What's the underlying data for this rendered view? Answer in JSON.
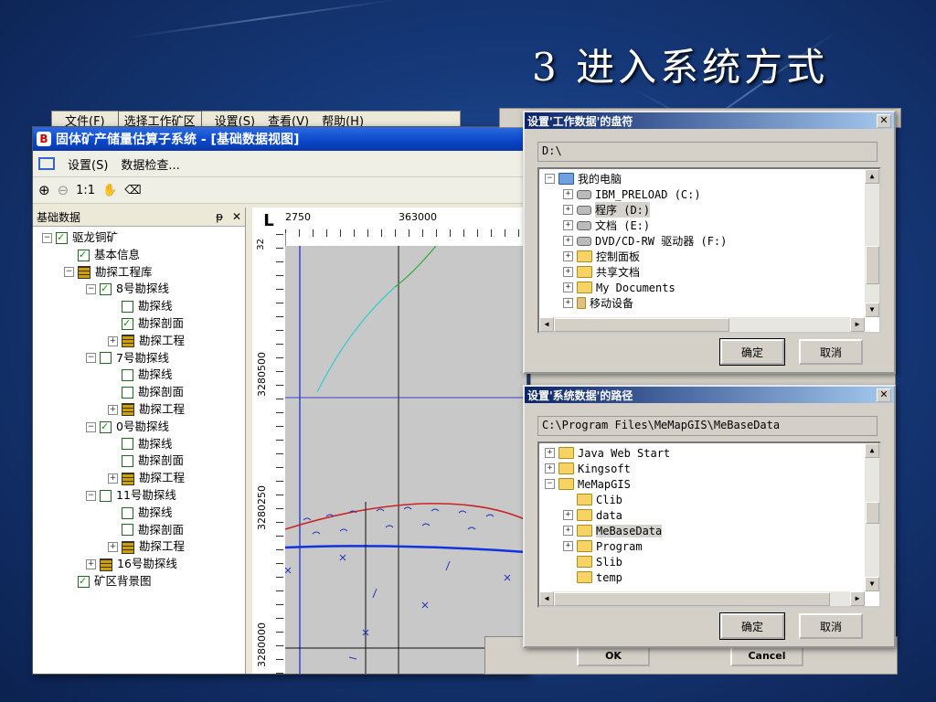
{
  "slide": {
    "title": "3 进入系统方式"
  },
  "back_window": {
    "menu": [
      "文件(F)",
      "选择工作矿区",
      "设置(S)",
      "查看(V)",
      "帮助(H)"
    ]
  },
  "app": {
    "title": "固体矿产储量估算子系统 - [基础数据视图]",
    "logo": "B",
    "toolbar1": {
      "settings": "设置(S)",
      "check": "数据检查..."
    },
    "toolbar2": {
      "zoom_in": "⊕",
      "zoom_out": "⊖",
      "ratio": "1:1",
      "hand": "✋",
      "eraser": "⌫"
    },
    "panel": {
      "title": "基础数据",
      "pin": "ᵽ",
      "close": "✕"
    },
    "tree": [
      {
        "indent": 0,
        "exp": "−",
        "chk": true,
        "label": "驱龙铜矿"
      },
      {
        "indent": 1,
        "exp": "",
        "chk": true,
        "label": "基本信息"
      },
      {
        "indent": 1,
        "exp": "−",
        "icon": "book",
        "label": "勘探工程库"
      },
      {
        "indent": 2,
        "exp": "−",
        "chk": true,
        "label": "8号勘探线"
      },
      {
        "indent": 3,
        "exp": "",
        "chk": false,
        "label": "勘探线"
      },
      {
        "indent": 3,
        "exp": "",
        "chk": true,
        "label": "勘探剖面"
      },
      {
        "indent": 3,
        "exp": "+",
        "icon": "book",
        "label": "勘探工程"
      },
      {
        "indent": 2,
        "exp": "−",
        "chk": false,
        "label": "7号勘探线"
      },
      {
        "indent": 3,
        "exp": "",
        "chk": false,
        "label": "勘探线"
      },
      {
        "indent": 3,
        "exp": "",
        "chk": false,
        "label": "勘探剖面"
      },
      {
        "indent": 3,
        "exp": "+",
        "icon": "book",
        "label": "勘探工程"
      },
      {
        "indent": 2,
        "exp": "−",
        "chk": true,
        "label": "0号勘探线"
      },
      {
        "indent": 3,
        "exp": "",
        "chk": false,
        "label": "勘探线"
      },
      {
        "indent": 3,
        "exp": "",
        "chk": false,
        "label": "勘探剖面"
      },
      {
        "indent": 3,
        "exp": "+",
        "icon": "book",
        "label": "勘探工程"
      },
      {
        "indent": 2,
        "exp": "−",
        "chk": false,
        "label": "11号勘探线"
      },
      {
        "indent": 3,
        "exp": "",
        "chk": false,
        "label": "勘探线"
      },
      {
        "indent": 3,
        "exp": "",
        "chk": false,
        "label": "勘探剖面"
      },
      {
        "indent": 3,
        "exp": "+",
        "icon": "book",
        "label": "勘探工程"
      },
      {
        "indent": 2,
        "exp": "+",
        "icon": "book",
        "label": "16号勘探线"
      },
      {
        "indent": 1,
        "exp": "",
        "chk": true,
        "label": "矿区背景图"
      }
    ],
    "map": {
      "ruler_top": [
        "2750",
        "363000"
      ],
      "ruler_left": [
        "32",
        "3280500",
        "3280250",
        "3280000"
      ],
      "corner": "L"
    }
  },
  "dialog1": {
    "title": "设置'工作数据'的盘符",
    "path": "D:\\",
    "items": [
      {
        "indent": 0,
        "exp": "−",
        "icon": "computer",
        "label": "我的电脑"
      },
      {
        "indent": 1,
        "exp": "+",
        "icon": "drive",
        "label": "IBM_PRELOAD (C:)"
      },
      {
        "indent": 1,
        "exp": "+",
        "icon": "drive",
        "label": "程序 (D:)",
        "selected": true
      },
      {
        "indent": 1,
        "exp": "+",
        "icon": "drive",
        "label": "文档 (E:)"
      },
      {
        "indent": 1,
        "exp": "+",
        "icon": "cdrom",
        "label": "DVD/CD-RW 驱动器 (F:)"
      },
      {
        "indent": 1,
        "exp": "+",
        "icon": "folder",
        "label": "控制面板"
      },
      {
        "indent": 1,
        "exp": "+",
        "icon": "folder",
        "label": "共享文档"
      },
      {
        "indent": 1,
        "exp": "+",
        "icon": "folder",
        "label": "My Documents"
      },
      {
        "indent": 1,
        "exp": "+",
        "icon": "usb",
        "label": "移动设备"
      }
    ],
    "ok": "确定",
    "cancel": "取消"
  },
  "dialog2": {
    "title": "设置'系统数据'的路径",
    "path": "C:\\Program Files\\MeMapGIS\\MeBaseData",
    "items": [
      {
        "indent": 0,
        "exp": "+",
        "label": "Java Web Start"
      },
      {
        "indent": 0,
        "exp": "+",
        "label": "Kingsoft"
      },
      {
        "indent": 0,
        "exp": "−",
        "label": "MeMapGIS"
      },
      {
        "indent": 1,
        "exp": "",
        "label": "Clib"
      },
      {
        "indent": 1,
        "exp": "+",
        "label": "data"
      },
      {
        "indent": 1,
        "exp": "+",
        "label": "MeBaseData",
        "selected": true
      },
      {
        "indent": 1,
        "exp": "+",
        "label": "Program"
      },
      {
        "indent": 1,
        "exp": "",
        "label": "Slib"
      },
      {
        "indent": 1,
        "exp": "",
        "label": "temp"
      }
    ],
    "ok": "确定",
    "cancel": "取消"
  },
  "back_dialog": {
    "ok": "OK",
    "cancel": "Cancel"
  }
}
